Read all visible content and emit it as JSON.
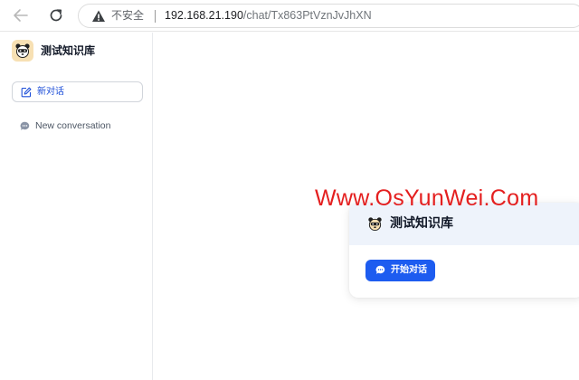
{
  "browser": {
    "back_icon": "arrow-left-icon",
    "reload_icon": "reload-icon",
    "security_icon": "warning-triangle-icon",
    "security_label": "不安全",
    "url_host": "192.168.21.190",
    "url_path": "/chat/Tx863PtVznJvJhXN"
  },
  "sidebar": {
    "app_logo_icon": "panda-logo-icon",
    "app_title": "测试知识库",
    "new_chat_icon": "edit-icon",
    "new_chat_label": "新对话",
    "conversations": [
      {
        "icon": "chat-bubble-icon",
        "label": "New conversation"
      }
    ]
  },
  "card": {
    "logo_icon": "panda-logo-icon",
    "title": "测试知识库",
    "start_icon": "chat-bubble-icon",
    "start_label": "开始对话"
  },
  "watermark": {
    "text": "Www.OsYunWei.Com"
  },
  "colors": {
    "accent": "#1d5cf0",
    "link": "#1d4ed8",
    "watermark": "#e41f1f",
    "card_header_bg": "#eef3fb"
  }
}
